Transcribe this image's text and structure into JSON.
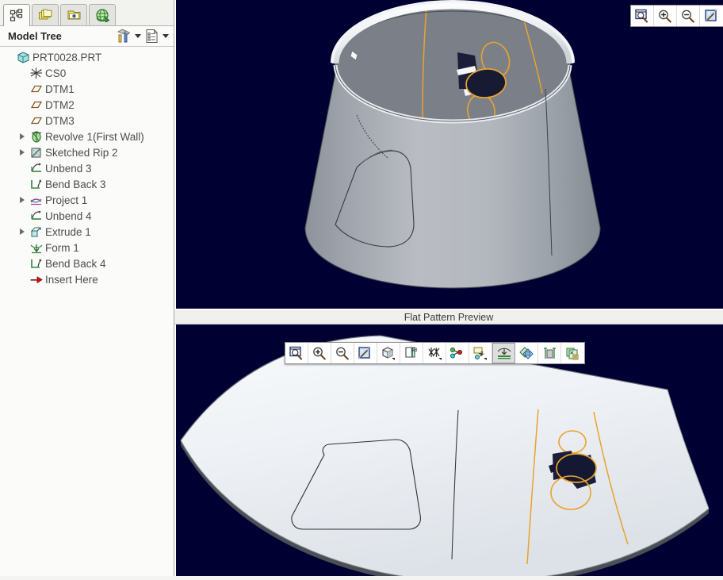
{
  "app": {
    "background_3d": "#000033",
    "panel_bg": "#fbfbfa",
    "model_color": "#a9adb4",
    "highlight_color": "#e8a32d"
  },
  "sidebar": {
    "tabs": [
      {
        "name": "model-tree-tab",
        "icon": "tree-structure-icon",
        "active": true
      },
      {
        "name": "folder-browser-tab",
        "icon": "folders-icon",
        "active": false
      },
      {
        "name": "favorites-folder-tab",
        "icon": "folder-star-icon",
        "active": false
      },
      {
        "name": "web-browser-tab",
        "icon": "globe-refresh-icon",
        "active": false
      }
    ],
    "header": {
      "title": "Model Tree",
      "settings_button": "tree-filters-icon",
      "settings_caret": "chevron-down-icon",
      "columns_button": "tree-columns-icon",
      "columns_caret": "chevron-down-icon"
    },
    "tree": [
      {
        "label": "PRT0028.PRT",
        "icon": "part-icon",
        "indent": 0,
        "expandable": false
      },
      {
        "label": "CS0",
        "icon": "coord-system-icon",
        "indent": 1,
        "expandable": false
      },
      {
        "label": "DTM1",
        "icon": "datum-plane-icon",
        "indent": 1,
        "expandable": false
      },
      {
        "label": "DTM2",
        "icon": "datum-plane-icon",
        "indent": 1,
        "expandable": false
      },
      {
        "label": "DTM3",
        "icon": "datum-plane-icon",
        "indent": 1,
        "expandable": false
      },
      {
        "label": "Revolve 1(First Wall)",
        "icon": "revolve-icon",
        "indent": 1,
        "expandable": true
      },
      {
        "label": "Sketched Rip 2",
        "icon": "sketched-rip-icon",
        "indent": 1,
        "expandable": true
      },
      {
        "label": "Unbend 3",
        "icon": "unbend-icon",
        "indent": 1,
        "expandable": false
      },
      {
        "label": "Bend Back 3",
        "icon": "bend-back-icon",
        "indent": 1,
        "expandable": false
      },
      {
        "label": "Project 1",
        "icon": "project-icon",
        "indent": 1,
        "expandable": true
      },
      {
        "label": "Unbend 4",
        "icon": "unbend-icon",
        "indent": 1,
        "expandable": false
      },
      {
        "label": "Extrude 1",
        "icon": "extrude-icon",
        "indent": 1,
        "expandable": true
      },
      {
        "label": "Form 1",
        "icon": "form-icon",
        "indent": 1,
        "expandable": false
      },
      {
        "label": "Bend Back 4",
        "icon": "bend-back-icon",
        "indent": 1,
        "expandable": false
      },
      {
        "label": "Insert Here",
        "icon": "insert-here-arrow-icon",
        "indent": 1,
        "expandable": false
      }
    ]
  },
  "viewport_3d": {
    "toolbar": [
      {
        "name": "refit-view-button",
        "icon": "zoom-to-fit-icon"
      },
      {
        "name": "zoom-in-button",
        "icon": "magnifier-plus-icon"
      },
      {
        "name": "zoom-out-button",
        "icon": "magnifier-minus-icon"
      },
      {
        "name": "repaint-button",
        "icon": "repaint-icon"
      }
    ]
  },
  "flat_pattern": {
    "title": "Flat Pattern Preview",
    "toolbar": [
      {
        "name": "refit-view-button",
        "icon": "zoom-to-fit-icon",
        "pressed": false
      },
      {
        "name": "zoom-in-button",
        "icon": "magnifier-plus-icon",
        "pressed": false
      },
      {
        "name": "zoom-out-button",
        "icon": "magnifier-minus-icon",
        "pressed": false
      },
      {
        "name": "repaint-button",
        "icon": "repaint-icon",
        "pressed": false
      },
      {
        "name": "display-style-button",
        "icon": "shaded-cube-icon",
        "pressed": false
      },
      {
        "name": "annotation-display-button",
        "icon": "annotation-ab-icon",
        "pressed": false
      },
      {
        "name": "datum-display-button",
        "icon": "datum-axes-icon",
        "pressed": false
      },
      {
        "name": "datum-point-button",
        "icon": "datum-points-icon",
        "pressed": false
      },
      {
        "name": "layer-display-button",
        "icon": "layer-visibility-icon",
        "pressed": false
      },
      {
        "name": "flat-state-button",
        "icon": "flat-state-icon",
        "pressed": true
      },
      {
        "name": "overlay-button",
        "icon": "overlay-sheets-icon",
        "pressed": false
      },
      {
        "name": "section-button",
        "icon": "section-view-icon",
        "pressed": false
      },
      {
        "name": "report-button",
        "icon": "report-sheets-icon",
        "pressed": false
      }
    ]
  }
}
